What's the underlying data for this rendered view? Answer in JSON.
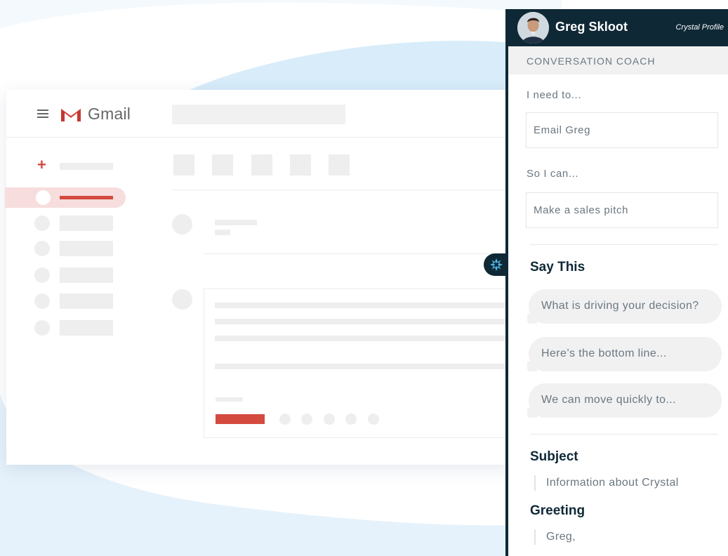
{
  "gmail": {
    "wordmark": "Gmail",
    "brand_red": "#d44a3f",
    "icons": [
      "menu-icon",
      "gmail-logo-icon",
      "compose-plus-icon"
    ]
  },
  "panel": {
    "theme_color": "#0f2836",
    "profile_name": "Greg Skloot",
    "profile_link": "Crystal Profile",
    "coach_title": "CONVERSATION COACH",
    "need_label": "I need to...",
    "need_value": "Email Greg",
    "goal_label": "So I can...",
    "goal_value": "Make a sales pitch",
    "say_this_title": "Say This",
    "suggestions": [
      "What is driving your decision?",
      "Here’s the bottom line...",
      "We can move quickly to..."
    ],
    "subject_title": "Subject",
    "subject_value": "Information about Crystal",
    "greeting_title": "Greeting",
    "greeting_value": "Greg,"
  }
}
